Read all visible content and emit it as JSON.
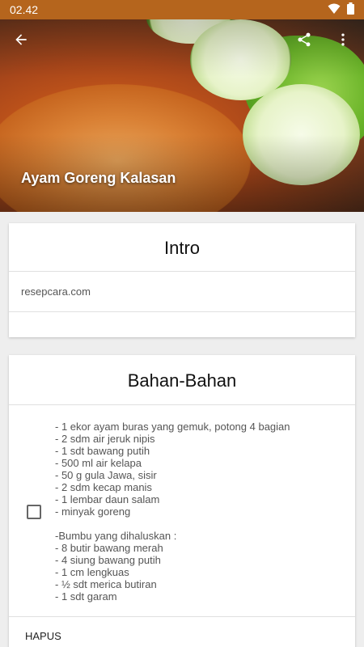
{
  "status_bar": {
    "time": "02.42",
    "bg_color": "#b5651d"
  },
  "header": {
    "title": "Ayam Goreng Kalasan",
    "back_icon": "arrow-back-icon",
    "share_icon": "share-icon",
    "menu_icon": "more-vert-icon"
  },
  "intro": {
    "title": "Intro",
    "source": "resepcara.com"
  },
  "bahan": {
    "title": "Bahan-Bahan",
    "ingredients_text": "- 1 ekor ayam buras yang gemuk, potong 4 bagian\n- 2 sdm air jeruk nipis\n- 1 sdt bawang putih\n- 500 ml air kelapa\n- 50 g gula Jawa, sisir\n- 2 sdm kecap manis\n- 1 lembar daun salam\n- minyak goreng\n\n-Bumbu yang dihaluskan :\n- 8 butir bawang merah\n- 4 siung bawang putih\n- 1 cm lengkuas\n- ½ sdt merica butiran\n- 1 sdt garam",
    "delete_label": "HAPUS"
  }
}
